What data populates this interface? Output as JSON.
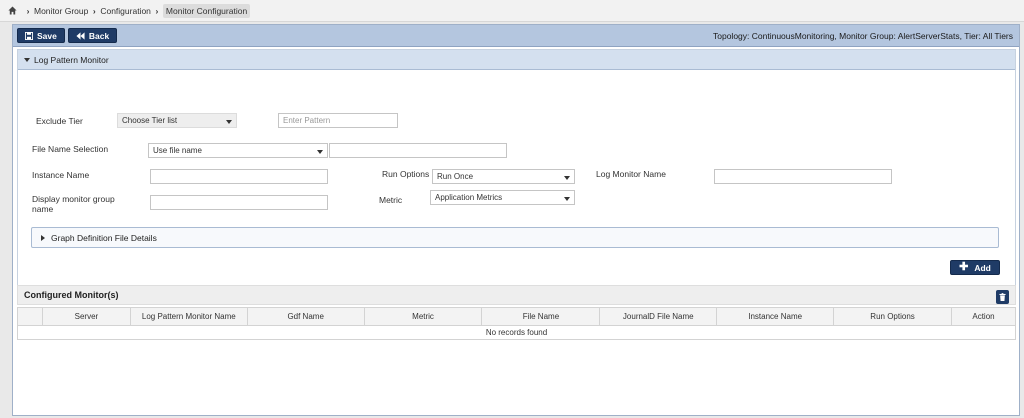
{
  "breadcrumb": {
    "items": [
      "Monitor Group",
      "Configuration",
      "Monitor Configuration"
    ]
  },
  "toolbar": {
    "save_label": "Save",
    "back_label": "Back",
    "topology_text": "Topology: ContinuousMonitoring, Monitor Group: AlertServerStats, Tier: All Tiers"
  },
  "log_pattern_panel": {
    "title": "Log Pattern Monitor",
    "exclude_tier_label": "Exclude Tier",
    "exclude_tier_value": "Choose Tier list",
    "pattern_placeholder": "Enter Pattern",
    "file_name_selection_label": "File Name Selection",
    "file_name_selection_value": "Use file name",
    "file_name_value": "",
    "instance_name_label": "Instance Name",
    "instance_name_value": "",
    "run_options_label": "Run Options",
    "run_options_value": "Run Once",
    "log_monitor_name_label": "Log Monitor Name",
    "log_monitor_name_value": "",
    "display_group_label_line1": "Display monitor group",
    "display_group_label_line2": "name",
    "display_group_value": "",
    "metric_label": "Metric",
    "metric_value": "Application Metrics",
    "gdf_title": "Graph Definition File Details",
    "add_label": "Add"
  },
  "configured": {
    "title": "Configured Monitor(s)",
    "columns": [
      "",
      "Server",
      "Log Pattern Monitor Name",
      "Gdf Name",
      "Metric",
      "File Name",
      "JournalD File Name",
      "Instance Name",
      "Run Options",
      "Action"
    ],
    "empty_message": "No records found"
  },
  "colors": {
    "primary_button": "#1f3b66",
    "toolbar_bg": "#b4c6df",
    "panel_header_bg": "#d4e0ef"
  }
}
